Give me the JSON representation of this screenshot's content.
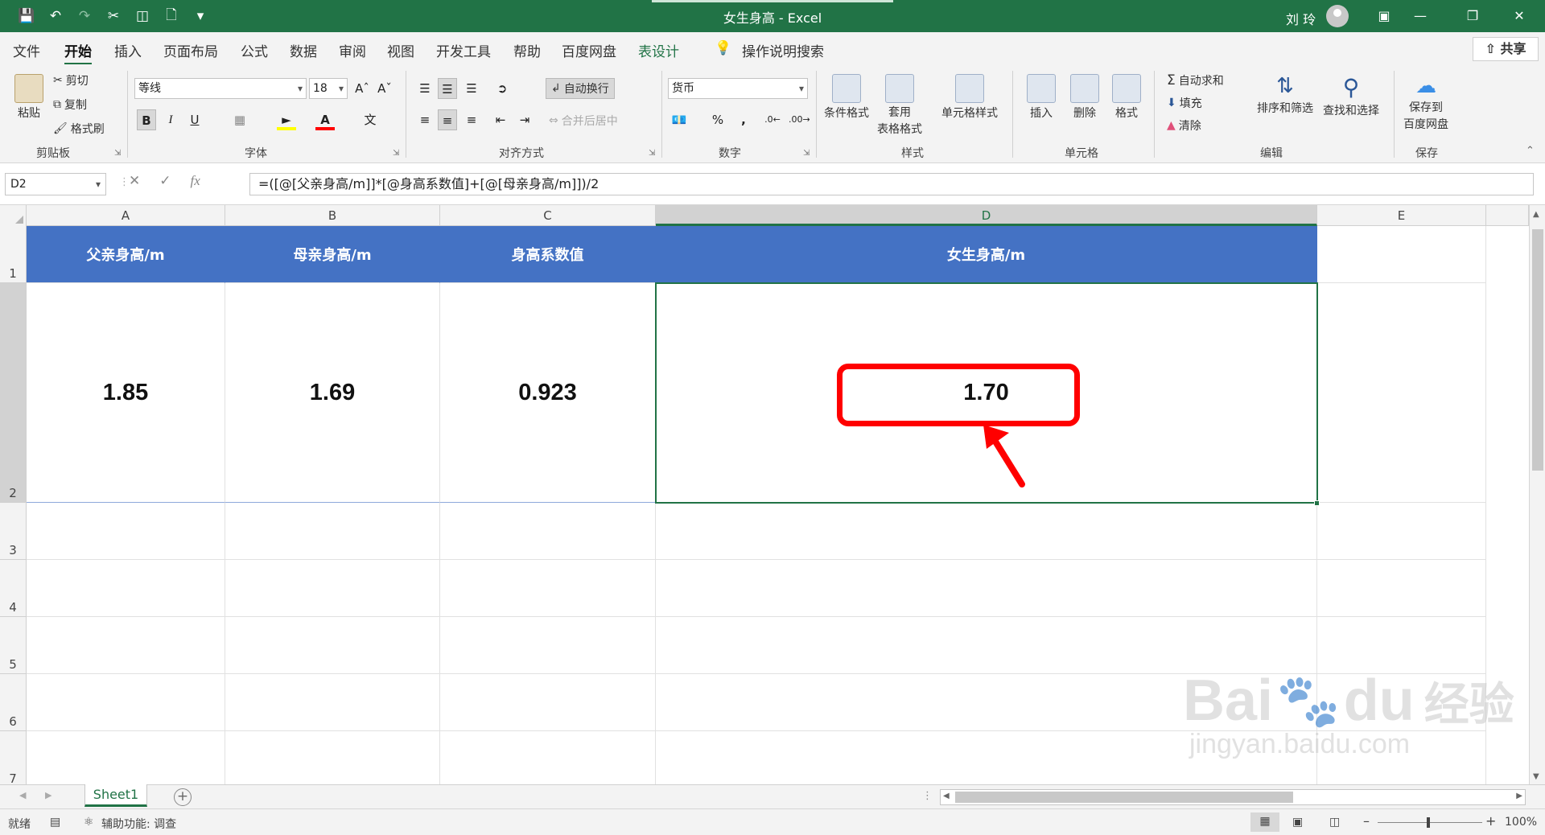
{
  "window": {
    "title": "女生身高 - Excel",
    "user": "刘 玲"
  },
  "ribbon_tabs": [
    "文件",
    "开始",
    "插入",
    "页面布局",
    "公式",
    "数据",
    "审阅",
    "视图",
    "开发工具",
    "帮助",
    "百度网盘",
    "表设计"
  ],
  "ribbon_active_tab": "开始",
  "tell_me": "操作说明搜索",
  "share": "共享",
  "ribbon": {
    "clipboard": {
      "paste": "粘贴",
      "cut": "剪切",
      "copy": "复制",
      "format_painter": "格式刷",
      "label": "剪贴板"
    },
    "font": {
      "name": "等线",
      "size": "18",
      "label": "字体",
      "bold": "B",
      "italic": "I",
      "underline": "U"
    },
    "alignment": {
      "wrap": "自动换行",
      "merge": "合并后居中",
      "label": "对齐方式"
    },
    "number": {
      "format": "货币",
      "percent": "%",
      "comma": ",",
      "label": "数字"
    },
    "styles": {
      "conditional": "条件格式",
      "table_fmt_1": "套用",
      "table_fmt_2": "表格格式",
      "cell_styles": "单元格样式",
      "label": "样式"
    },
    "cells": {
      "insert": "插入",
      "delete": "删除",
      "format": "格式",
      "label": "单元格"
    },
    "editing": {
      "autosum": "自动求和",
      "fill": "填充",
      "clear": "清除",
      "sort": "排序和筛选",
      "find": "查找和选择",
      "label": "编辑"
    },
    "save": {
      "line1": "保存到",
      "line2": "百度网盘",
      "label": "保存"
    }
  },
  "formula_bar": {
    "name_box": "D2",
    "fx": "fx",
    "formula": "=([@[父亲身高/m]]*[@身高系数值]+[@[母亲身高/m]])/2"
  },
  "columns": [
    "A",
    "B",
    "C",
    "D",
    "E"
  ],
  "rows": [
    "1",
    "2",
    "3",
    "4",
    "5",
    "6",
    "7"
  ],
  "table": {
    "headers": [
      "父亲身高/m",
      "母亲身高/m",
      "身高系数值",
      "女生身高/m"
    ],
    "values": [
      "1.85",
      "1.69",
      "0.923",
      "1.70"
    ]
  },
  "sheet_tab": "Sheet1",
  "status": {
    "ready": "就绪",
    "accessibility": "辅助功能: 调查",
    "zoom": "100%"
  },
  "watermark": {
    "brand": "Bai",
    "brand2": "du",
    "cn": "经验",
    "url": "jingyan.baidu.com"
  },
  "colors": {
    "excel_green": "#217346",
    "header_blue": "#4472c4",
    "annotation_red": "#ff0000"
  }
}
